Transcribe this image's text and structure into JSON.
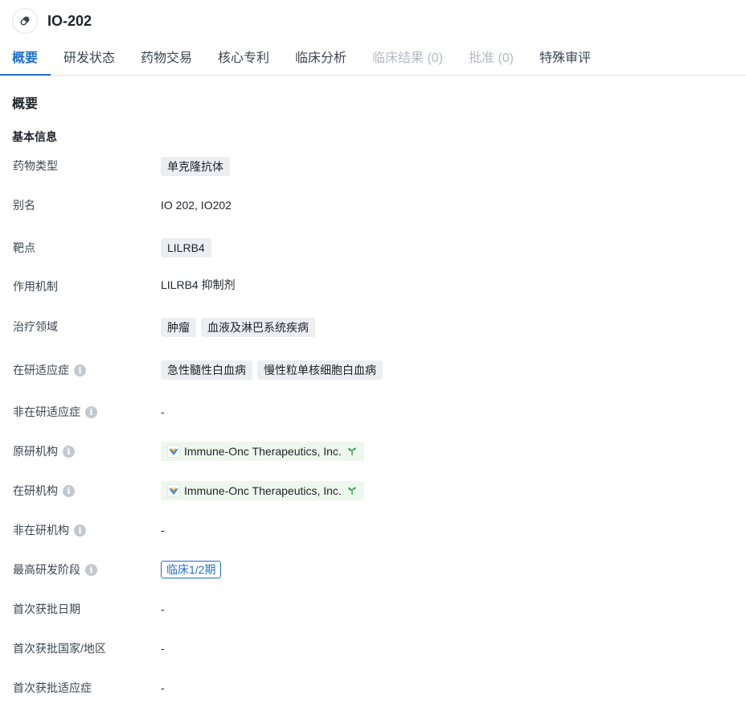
{
  "header": {
    "title": "IO-202",
    "icon": "pill-icon"
  },
  "tabs": [
    {
      "label": "概要",
      "active": true,
      "disabled": false
    },
    {
      "label": "研发状态",
      "active": false,
      "disabled": false
    },
    {
      "label": "药物交易",
      "active": false,
      "disabled": false
    },
    {
      "label": "核心专利",
      "active": false,
      "disabled": false
    },
    {
      "label": "临床分析",
      "active": false,
      "disabled": false
    },
    {
      "label": "临床结果 (0)",
      "active": false,
      "disabled": true
    },
    {
      "label": "批准 (0)",
      "active": false,
      "disabled": true
    },
    {
      "label": "特殊审评",
      "active": false,
      "disabled": false
    }
  ],
  "section_title": "概要",
  "group_title": "基本信息",
  "rows": {
    "drug_type": {
      "label": "药物类型",
      "tags": [
        "单克隆抗体"
      ]
    },
    "alias": {
      "label": "别名",
      "value": "IO 202,  IO202"
    },
    "target": {
      "label": "靶点",
      "tags": [
        "LILRB4"
      ]
    },
    "mechanism": {
      "label": "作用机制",
      "value": "LILRB4 抑制剂"
    },
    "therapeutic_area": {
      "label": "治疗领域",
      "tags": [
        "肿瘤",
        "血液及淋巴系统疾病"
      ]
    },
    "active_indication": {
      "label": "在研适应症",
      "tags": [
        "急性髓性白血病",
        "慢性粒单核细胞白血病"
      ]
    },
    "inactive_indication": {
      "label": "非在研适应症",
      "value": "-"
    },
    "originator": {
      "label": "原研机构",
      "org": "Immune-Onc Therapeutics, Inc."
    },
    "active_org": {
      "label": "在研机构",
      "org": "Immune-Onc Therapeutics, Inc."
    },
    "inactive_org": {
      "label": "非在研机构",
      "value": "-"
    },
    "highest_phase": {
      "label": "最高研发阶段",
      "phase": "临床1/2期"
    },
    "first_approval_date": {
      "label": "首次获批日期",
      "value": "-"
    },
    "first_approval_region": {
      "label": "首次获批国家/地区",
      "value": "-"
    },
    "first_approval_indication": {
      "label": "首次获批适应症",
      "value": "-"
    }
  },
  "colors": {
    "accent": "#1f6fce",
    "tag_bg": "#eceef2",
    "org_bg": "#eef7ee",
    "sprout": "#2ea043"
  }
}
